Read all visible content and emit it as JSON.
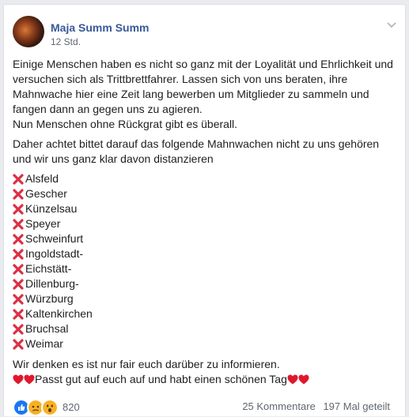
{
  "post": {
    "author": "Maja Summ Summ",
    "time": "12 Std.",
    "paragraphs": [
      "Einige Menschen haben es nicht so ganz mit der Loyalität und Ehrlichkeit und versuchen sich als Trittbrettfahrer. Lassen sich von uns beraten, ihre Mahnwache hier eine Zeit lang bewerben um Mitglieder zu sammeln und fangen dann an gegen uns zu agieren.",
      "Nun Menschen ohne Rückgrat gibt es überall.",
      "Daher achtet bittet darauf das folgende Mahnwachen nicht zu uns gehören und wir uns ganz klar davon distanzieren"
    ],
    "list_icon": "cross-mark-icon",
    "locations": [
      "Alsfeld",
      "Gescher",
      "Künzelsau",
      "Speyer",
      "Schweinfurt",
      "Ingoldstadt-",
      "Eichstätt-",
      "Dillenburg-",
      "Würzburg",
      "Kaltenkirchen",
      "Bruchsal",
      "Weimar"
    ],
    "closing_line": "Wir denken es ist nur fair euch darüber zu informieren.",
    "closing_wish": "Passt gut auf euch auf und habt einen schönen Tag"
  },
  "footer": {
    "reaction_icons": [
      "like-icon",
      "sad-icon",
      "wow-icon"
    ],
    "reaction_count": "820",
    "comments": "25 Kommentare",
    "shares": "197 Mal geteilt"
  },
  "colors": {
    "author": "#385898",
    "text": "#1c1e21",
    "meta": "#606770",
    "cross": "#dd2e44",
    "heart": "#e0182d",
    "like": "#1877f2"
  }
}
